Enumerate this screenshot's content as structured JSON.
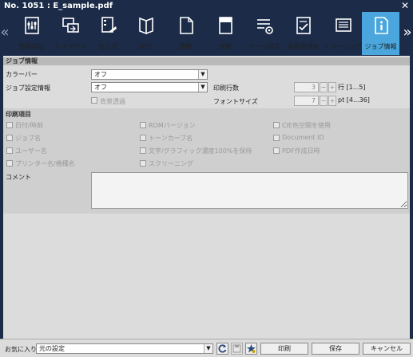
{
  "window": {
    "title": "No. 1051 : E_sample.pdf",
    "close": "✕"
  },
  "nav": {
    "left": "«",
    "right": "»"
  },
  "tabs": [
    {
      "label": "簡易設定",
      "icon": "quick-settings-icon"
    },
    {
      "label": "レイアウト",
      "icon": "layout-icon"
    },
    {
      "label": "仕上げ",
      "icon": "finishing-icon"
    },
    {
      "label": "折り",
      "icon": "fold-icon"
    },
    {
      "label": "用紙",
      "icon": "paper-icon"
    },
    {
      "label": "表紙",
      "icon": "cover-icon"
    },
    {
      "label": "ページ設定",
      "icon": "page-settings-icon"
    },
    {
      "label": "品質最適化",
      "icon": "quality-icon"
    },
    {
      "label": "イメージング",
      "icon": "imaging-icon"
    },
    {
      "label": "ジョブ情報",
      "icon": "job-info-icon",
      "active": true
    }
  ],
  "job_info": {
    "header": "ジョブ情報",
    "color_bar_label": "カラーバー",
    "color_bar_value": "オフ",
    "job_setting_label": "ジョブ設定情報",
    "job_setting_value": "オフ",
    "bg_transparent": "背景透過",
    "print_lines_label": "印刷行数",
    "print_lines_value": "3",
    "print_lines_range": "行 [1...5]",
    "font_size_label": "フォントサイズ",
    "font_size_value": "7",
    "font_size_range": "pt [4...36]",
    "minus": "−",
    "plus": "+"
  },
  "print_items": {
    "header": "印刷項目",
    "items": [
      "日付/時刻",
      "ROMバージョン",
      "CIE色空間を使用",
      "ジョブ名",
      "トーンカーブ名",
      "Document ID",
      "ユーザー名",
      "文字/グラフィック濃度100%を保持",
      "PDF作成日時",
      "プリンター名/機種名",
      "スクリーニング"
    ]
  },
  "comment": {
    "label": "コメント"
  },
  "footer": {
    "favorites_label": "お気に入り",
    "favorites_value": "元の設定",
    "print": "印刷",
    "save": "保存",
    "cancel": "キャンセル"
  }
}
